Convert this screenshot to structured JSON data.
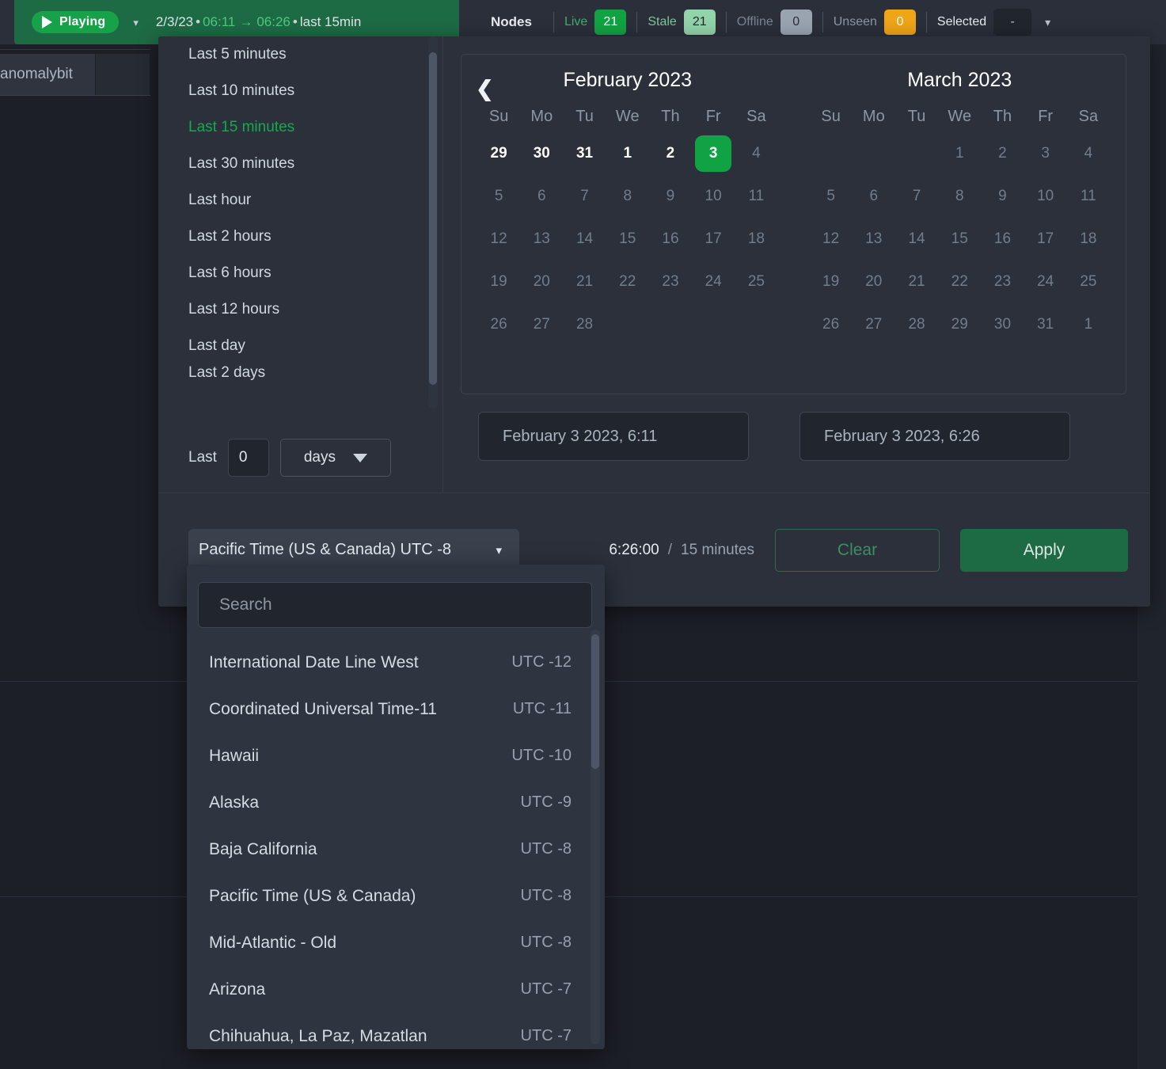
{
  "topbar": {
    "playing_label": "Playing",
    "playing_chevron": "chevron-down-icon",
    "range_date": "2/3/23",
    "range_from": "06:11",
    "range_to": "06:26",
    "range_suffix": "last 15min",
    "dot": "•",
    "arrow": "→",
    "nodes_label": "Nodes",
    "stats": [
      {
        "name": "Live",
        "value": "21",
        "name_color": "#3fae6a",
        "bg": "#11a343",
        "fg": "#ffffff"
      },
      {
        "name": "Stale",
        "value": "21",
        "name_color": "#7fc79a",
        "bg": "#92d3ab",
        "fg": "#1f2a24"
      },
      {
        "name": "Offline",
        "value": "0",
        "name_color": "#7b848f",
        "bg": "#9aa4b0",
        "fg": "#2a2f38"
      },
      {
        "name": "Unseen",
        "value": "0",
        "name_color": "#8d96a3",
        "bg": "#f0a417",
        "fg": "#ffffff"
      }
    ],
    "selected_label": "Selected",
    "selected_value": "-",
    "selected_chevron": "chevron-down-icon"
  },
  "sidebar": {
    "fragment_label": "anomalybit"
  },
  "picker": {
    "presets": [
      {
        "label": "Last 5 minutes",
        "active": false
      },
      {
        "label": "Last 10 minutes",
        "active": false
      },
      {
        "label": "Last 15 minutes",
        "active": true
      },
      {
        "label": "Last 30 minutes",
        "active": false
      },
      {
        "label": "Last hour",
        "active": false
      },
      {
        "label": "Last 2 hours",
        "active": false
      },
      {
        "label": "Last 6 hours",
        "active": false
      },
      {
        "label": "Last 12 hours",
        "active": false
      },
      {
        "label": "Last day",
        "active": false
      },
      {
        "label": "Last 2 days",
        "active": false
      }
    ],
    "custom": {
      "last_label": "Last",
      "amount": "0",
      "unit": "days",
      "unit_chevron": "triangle-down-icon"
    },
    "calendar": {
      "prev_icon": "chevron-left-icon",
      "dow": [
        "Su",
        "Mo",
        "Tu",
        "We",
        "Th",
        "Fr",
        "Sa"
      ],
      "months": [
        {
          "title": "February 2023",
          "weeks": [
            [
              {
                "d": "29",
                "state": "range"
              },
              {
                "d": "30",
                "state": "range"
              },
              {
                "d": "31",
                "state": "range"
              },
              {
                "d": "1",
                "state": "range"
              },
              {
                "d": "2",
                "state": "range"
              },
              {
                "d": "3",
                "state": "today"
              },
              {
                "d": "4",
                "state": "dim"
              }
            ],
            [
              {
                "d": "5",
                "state": "dim"
              },
              {
                "d": "6",
                "state": "dim"
              },
              {
                "d": "7",
                "state": "dim"
              },
              {
                "d": "8",
                "state": "dim"
              },
              {
                "d": "9",
                "state": "dim"
              },
              {
                "d": "10",
                "state": "dim"
              },
              {
                "d": "11",
                "state": "dim"
              }
            ],
            [
              {
                "d": "12",
                "state": "dim"
              },
              {
                "d": "13",
                "state": "dim"
              },
              {
                "d": "14",
                "state": "dim"
              },
              {
                "d": "15",
                "state": "dim"
              },
              {
                "d": "16",
                "state": "dim"
              },
              {
                "d": "17",
                "state": "dim"
              },
              {
                "d": "18",
                "state": "dim"
              }
            ],
            [
              {
                "d": "19",
                "state": "dim"
              },
              {
                "d": "20",
                "state": "dim"
              },
              {
                "d": "21",
                "state": "dim"
              },
              {
                "d": "22",
                "state": "dim"
              },
              {
                "d": "23",
                "state": "dim"
              },
              {
                "d": "24",
                "state": "dim"
              },
              {
                "d": "25",
                "state": "dim"
              }
            ],
            [
              {
                "d": "26",
                "state": "dim"
              },
              {
                "d": "27",
                "state": "dim"
              },
              {
                "d": "28",
                "state": "dim"
              },
              {
                "d": "",
                "state": "empty"
              },
              {
                "d": "",
                "state": "empty"
              },
              {
                "d": "",
                "state": "empty"
              },
              {
                "d": "",
                "state": "empty"
              }
            ]
          ]
        },
        {
          "title": "March 2023",
          "weeks": [
            [
              {
                "d": "",
                "state": "empty"
              },
              {
                "d": "",
                "state": "empty"
              },
              {
                "d": "",
                "state": "empty"
              },
              {
                "d": "1",
                "state": "dim"
              },
              {
                "d": "2",
                "state": "dim"
              },
              {
                "d": "3",
                "state": "dim"
              },
              {
                "d": "4",
                "state": "dim"
              }
            ],
            [
              {
                "d": "5",
                "state": "dim"
              },
              {
                "d": "6",
                "state": "dim"
              },
              {
                "d": "7",
                "state": "dim"
              },
              {
                "d": "8",
                "state": "dim"
              },
              {
                "d": "9",
                "state": "dim"
              },
              {
                "d": "10",
                "state": "dim"
              },
              {
                "d": "11",
                "state": "dim"
              }
            ],
            [
              {
                "d": "12",
                "state": "dim"
              },
              {
                "d": "13",
                "state": "dim"
              },
              {
                "d": "14",
                "state": "dim"
              },
              {
                "d": "15",
                "state": "dim"
              },
              {
                "d": "16",
                "state": "dim"
              },
              {
                "d": "17",
                "state": "dim"
              },
              {
                "d": "18",
                "state": "dim"
              }
            ],
            [
              {
                "d": "19",
                "state": "dim"
              },
              {
                "d": "20",
                "state": "dim"
              },
              {
                "d": "21",
                "state": "dim"
              },
              {
                "d": "22",
                "state": "dim"
              },
              {
                "d": "23",
                "state": "dim"
              },
              {
                "d": "24",
                "state": "dim"
              },
              {
                "d": "25",
                "state": "dim"
              }
            ],
            [
              {
                "d": "26",
                "state": "dim"
              },
              {
                "d": "27",
                "state": "dim"
              },
              {
                "d": "28",
                "state": "dim"
              },
              {
                "d": "29",
                "state": "dim"
              },
              {
                "d": "30",
                "state": "dim"
              },
              {
                "d": "31",
                "state": "dim"
              },
              {
                "d": "1",
                "state": "dim"
              }
            ]
          ]
        }
      ]
    },
    "date_from": "February 3 2023, 6:11",
    "date_to": "February 3 2023, 6:26",
    "footer": {
      "timezone_value": "Pacific Time (US & Canada) UTC -8",
      "timezone_chevron": "chevron-down-icon",
      "summary_time": "6:26:00",
      "summary_slash": "/",
      "summary_duration": "15 minutes",
      "clear_label": "Clear",
      "apply_label": "Apply"
    }
  },
  "timezone_dropdown": {
    "search_placeholder": "Search",
    "items": [
      {
        "name": "International Date Line West",
        "offset": "UTC -12"
      },
      {
        "name": "Coordinated Universal Time-11",
        "offset": "UTC -11"
      },
      {
        "name": "Hawaii",
        "offset": "UTC -10"
      },
      {
        "name": "Alaska",
        "offset": "UTC -9"
      },
      {
        "name": "Baja California",
        "offset": "UTC -8"
      },
      {
        "name": "Pacific Time (US & Canada)",
        "offset": "UTC -8"
      },
      {
        "name": "Mid-Atlantic - Old",
        "offset": "UTC -8"
      },
      {
        "name": "Arizona",
        "offset": "UTC -7"
      },
      {
        "name": "Chihuahua, La Paz, Mazatlan",
        "offset": "UTC -7"
      }
    ]
  }
}
